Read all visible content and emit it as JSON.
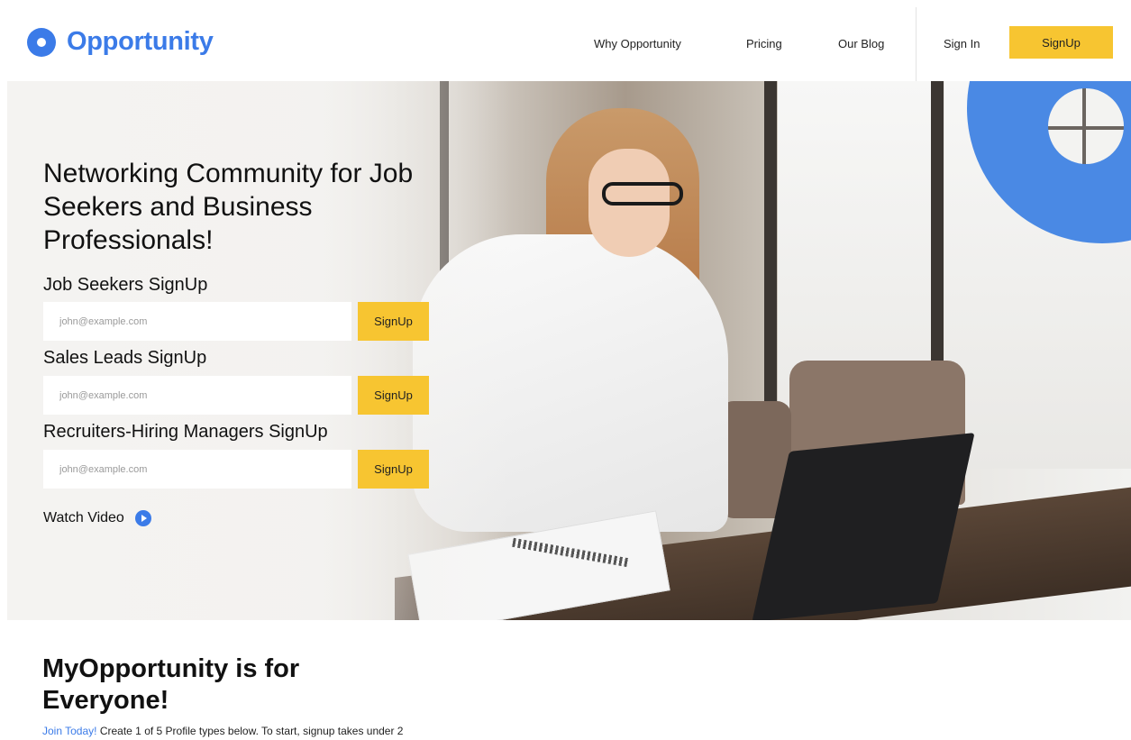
{
  "brand": {
    "name": "Opportunity",
    "accent": "#3b7be8",
    "cta_color": "#f7c531"
  },
  "nav": {
    "why": "Why Opportunity",
    "pricing": "Pricing",
    "blog": "Our Blog",
    "signin": "Sign In",
    "signup": "SignUp"
  },
  "hero": {
    "title": "Networking Community for Job Seekers and Business Professionals!",
    "forms": [
      {
        "label": "Job Seekers SignUp",
        "placeholder": "john@example.com",
        "button": "SignUp"
      },
      {
        "label": "Sales Leads SignUp",
        "placeholder": "john@example.com",
        "button": "SignUp"
      },
      {
        "label": "Recruiters-Hiring Managers SignUp",
        "placeholder": "john@example.com",
        "button": "SignUp"
      }
    ],
    "watch_video": "Watch Video",
    "watch_icon": "play-icon"
  },
  "section": {
    "title": "MyOpportunity is for Everyone!",
    "join_link": "Join Today!",
    "text": " Create 1 of 5 Profile types below. To start, signup takes under 2"
  }
}
